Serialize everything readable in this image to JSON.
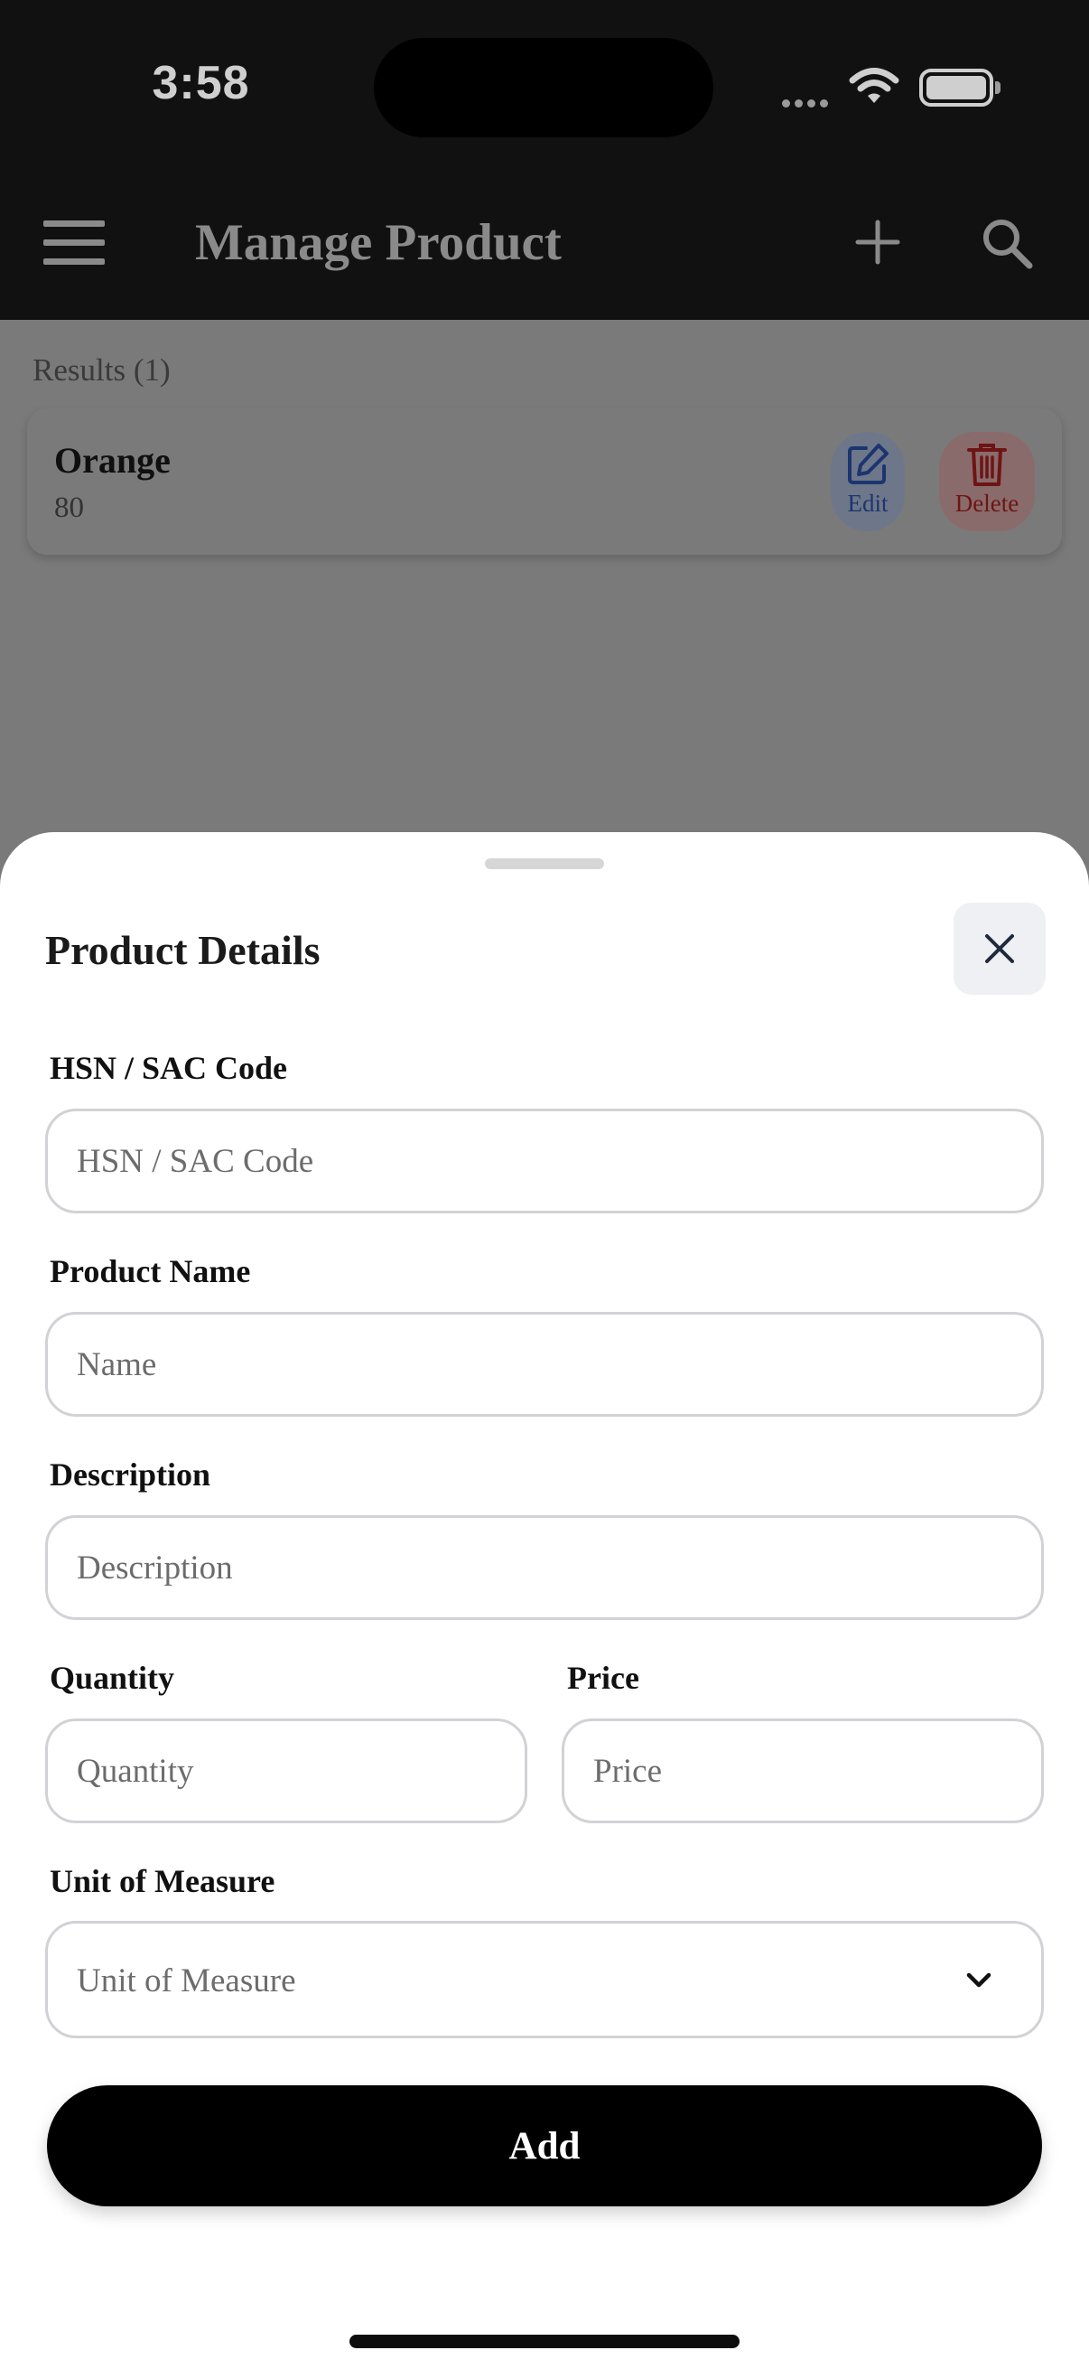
{
  "status_bar": {
    "time": "3:58"
  },
  "header": {
    "title": "Manage Product"
  },
  "results": {
    "label": "Results (1)",
    "items": [
      {
        "name": "Orange",
        "value": "80"
      }
    ],
    "edit_label": "Edit",
    "delete_label": "Delete"
  },
  "sheet": {
    "title": "Product Details",
    "fields": {
      "hsn": {
        "label": "HSN / SAC Code",
        "placeholder": "HSN / SAC Code"
      },
      "name": {
        "label": "Product Name",
        "placeholder": "Name"
      },
      "description": {
        "label": "Description",
        "placeholder": "Description"
      },
      "quantity": {
        "label": "Quantity",
        "placeholder": "Quantity"
      },
      "price": {
        "label": "Price",
        "placeholder": "Price"
      },
      "unit": {
        "label": "Unit of Measure",
        "selected": "Unit of Measure"
      }
    },
    "submit_label": "Add"
  },
  "colors": {
    "accent_edit": "#1b3570",
    "accent_delete": "#6e1414",
    "primary_button": "#000000"
  },
  "icons": [
    "menu-icon",
    "plus-icon",
    "search-icon",
    "edit-icon",
    "trash-icon",
    "close-icon",
    "chevron-down-icon",
    "wifi-icon",
    "battery-icon"
  ]
}
